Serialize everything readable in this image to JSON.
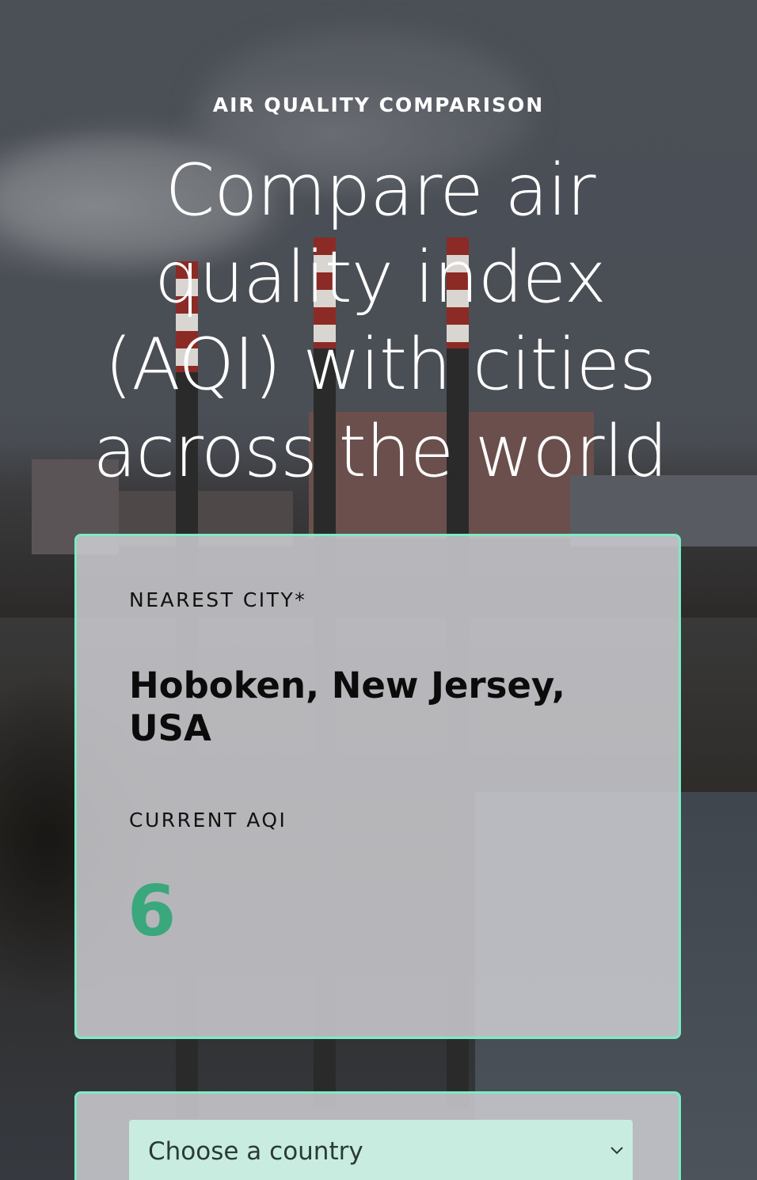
{
  "hero": {
    "eyebrow": "AIR QUALITY COMPARISON",
    "headline": "Compare air quality index (AQI) with cities across the world"
  },
  "nearest_card": {
    "city_label": "NEAREST CITY*",
    "city_value": "Hoboken, New Jersey, USA",
    "aqi_label": "CURRENT AQI",
    "aqi_value": "6"
  },
  "country_select": {
    "selected": "Choose a country",
    "icon": "chevron-down-icon"
  },
  "colors": {
    "accent_border": "#7debc3",
    "aqi_good": "#3aa77d",
    "select_bg": "#c8ede0"
  }
}
